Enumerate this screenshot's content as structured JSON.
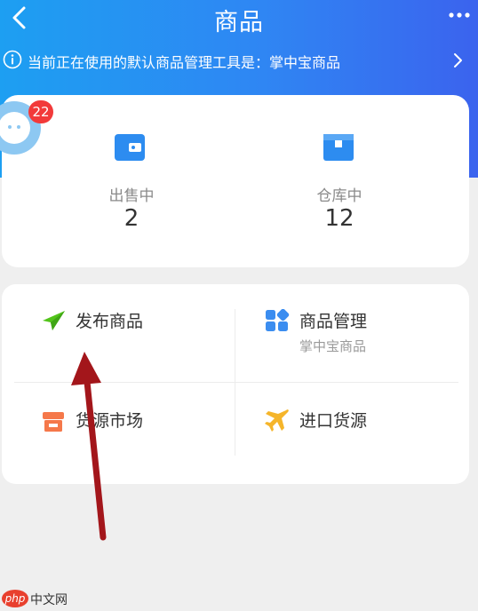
{
  "header": {
    "title": "商品",
    "back_icon": "chevron-left-icon",
    "more_icon": "more-dots-icon"
  },
  "notice": {
    "text": "当前正在使用的默认商品管理工具是：掌中宝商品",
    "info_icon": "info-icon",
    "chevron_icon": "chevron-right-icon"
  },
  "floating": {
    "badge": "22"
  },
  "stats": [
    {
      "label": "出售中",
      "value": "2",
      "icon": "wallet-icon",
      "color": "#2d8cf0"
    },
    {
      "label": "仓库中",
      "value": "12",
      "icon": "warehouse-box-icon",
      "color": "#2d8cf0"
    }
  ],
  "menu": [
    {
      "label": "发布商品",
      "sub": "",
      "icon": "paper-plane-icon",
      "color": "#52c41a"
    },
    {
      "label": "商品管理",
      "sub": "掌中宝商品",
      "icon": "grid-tiles-icon",
      "color": "#3b8df0"
    },
    {
      "label": "货源市场",
      "sub": "",
      "icon": "store-icon",
      "color": "#f5784a"
    },
    {
      "label": "进口货源",
      "sub": "",
      "icon": "airplane-icon",
      "color": "#f5b52a"
    }
  ],
  "annotation": {
    "arrow_color": "#a3161b"
  },
  "watermark": {
    "logo": "php",
    "text": "中文网"
  },
  "colors": {
    "header_start": "#1d9ff2",
    "header_end": "#3b63ee",
    "badge": "#f23a3a",
    "background": "#efefef"
  }
}
